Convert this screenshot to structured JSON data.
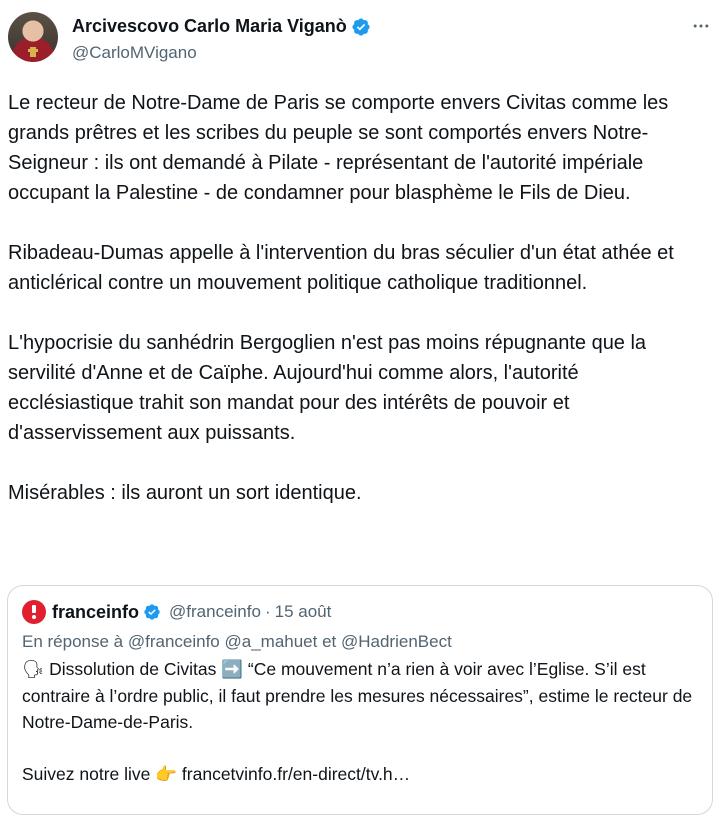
{
  "author": {
    "display_name": "Arcivescovo Carlo Maria Viganò",
    "handle": "@CarloMVigano",
    "avatar_icon": "avatar-photo",
    "verified_icon": "verified-badge-icon"
  },
  "tweet": {
    "text": "Le recteur de Notre-Dame de Paris se comporte envers Civitas comme les grands prêtres et les scribes du peuple se sont comportés envers Notre-Seigneur : ils ont demandé à Pilate - représentant de l'autorité impériale occupant la Palestine - de condamner pour blasphème le Fils de Dieu.\n\nRibadeau-Dumas appelle à l'intervention du bras séculier d'un état athée et anticlérical contre un mouvement politique catholique traditionnel.\n\nL'hypocrisie du sanhédrin Bergoglien n'est pas moins répugnante que la servilité d'Anne et de Caïphe. Aujourd'hui comme alors, l'autorité ecclésiastique trahit son mandat pour des intérêts de pouvoir et d'asservissement aux puissants.\n\nMisérables : ils auront un sort identique."
  },
  "quoted": {
    "display_name": "franceinfo",
    "handle": "@franceinfo",
    "separator": "·",
    "date": "15 août",
    "reply_to": "En réponse à @franceinfo @a_mahuet  et  @HadrienBect",
    "text_part1": " Dissolution de Civitas ",
    "text_part2": " “Ce mouvement n’a rien à voir avec l’Eglise. S’il est contraire à l’ordre public, il faut prendre les mesures nécessaires”, estime le recteur de Notre-Dame-de-Paris.\n\nSuivez notre live ",
    "text_part3": " francetvinfo.fr/en-direct/tv.h…",
    "emoji_speaking": "🗣",
    "emoji_arrow": "➡️",
    "emoji_point": "👉"
  },
  "colors": {
    "text": "#0f1419",
    "secondary": "#536471",
    "verified": "#1d9bf0",
    "border": "#cfd9de",
    "franceinfo_red": "#e0202f"
  }
}
